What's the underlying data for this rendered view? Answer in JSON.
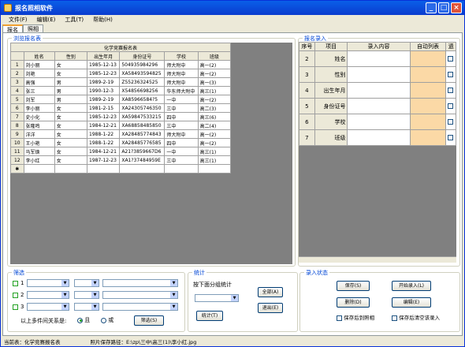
{
  "window": {
    "title": "报名照相软件"
  },
  "menu": [
    "文件(F)",
    "编辑(E)",
    "工具(T)",
    "帮助(H)"
  ],
  "tabs": [
    "报名",
    "照相"
  ],
  "left_group": {
    "title": "浏览报名表",
    "table_caption": "化学竞赛报名表",
    "columns": [
      "姓名",
      "性别",
      "出生年月",
      "身份证号",
      "学校",
      "班级"
    ],
    "rows": [
      [
        "1",
        "刘小丽",
        "女",
        "1985-12-13",
        "504935984296",
        "师大附中",
        "高一(2)"
      ],
      [
        "2",
        "刘艳",
        "女",
        "1985-12-23",
        "XA58493594825",
        "师大附中",
        "高一(2)"
      ],
      [
        "3",
        "高强",
        "男",
        "1989-2-19",
        "Z55236324525",
        "师大附中",
        "高一(3)"
      ],
      [
        "4",
        "张三",
        "男",
        "1990-12-3",
        "X54856698256",
        "华东师大附中",
        "高三(1)"
      ],
      [
        "5",
        "刘军",
        "男",
        "1989-2-19",
        "XA85966584?5",
        "一中",
        "高一(2)"
      ],
      [
        "6",
        "李小丽",
        "女",
        "1981-2-15",
        "XA24305746350",
        "三中",
        "高二(3)"
      ],
      [
        "7",
        "史小化",
        "女",
        "1985-12-23",
        "XA59847533215",
        "四中",
        "高三(6)"
      ],
      [
        "8",
        "张隆鸣",
        "女",
        "1984-12-21",
        "XA68858485850",
        "三中",
        "高二(4)"
      ],
      [
        "9",
        "洋洋",
        "女",
        "1988-1-22",
        "XA28485774843",
        "师大附中",
        "高一(2)"
      ],
      [
        "10",
        "王小艳",
        "女",
        "1988-1-22",
        "XA28485776585",
        "四中",
        "高一(2)"
      ],
      [
        "11",
        "马军焕",
        "女",
        "1984-12-21",
        "A21?3859667D6",
        "一中",
        "高三(1)"
      ],
      [
        "12",
        "李小红",
        "女",
        "1987-12-23",
        "XA1?37484959E",
        "三中",
        "高三(1)"
      ]
    ],
    "new_row_marker": "✱"
  },
  "right_group": {
    "title": "报名录入",
    "columns": [
      "序号",
      "项目",
      "录入内容",
      "自动列表",
      "遗"
    ],
    "rows": [
      [
        "2",
        "姓名"
      ],
      [
        "3",
        "性别"
      ],
      [
        "4",
        "出生年月"
      ],
      [
        "5",
        "身份证号"
      ],
      [
        "6",
        "学校"
      ],
      [
        "7",
        "班级"
      ]
    ]
  },
  "filter": {
    "title": "筛选",
    "row_labels": [
      "1",
      "2",
      "3"
    ],
    "relation_label": "以上多件间关系是:",
    "and_label": "且",
    "or_label": "或",
    "filter_button": "筛选(S)"
  },
  "stats": {
    "title": "统计",
    "prompt": "按下面分组统计",
    "stats_button": "统计(T)",
    "all_button": "全部(A)",
    "exit_button": "退出(E)"
  },
  "entry": {
    "title": "录入状态",
    "save_button": "保存(S)",
    "start_button": "开始录入(L)",
    "delete_button": "删除(D)",
    "edit_button": "编辑(E)",
    "check1": "保存后到照相",
    "check2": "保存后清空该录入"
  },
  "status": {
    "current_table": "当前表：化学竞赛报名表",
    "photo_path": "照片保存路径：E:\\zp\\三中\\高三(1)\\李小红.jpg"
  }
}
